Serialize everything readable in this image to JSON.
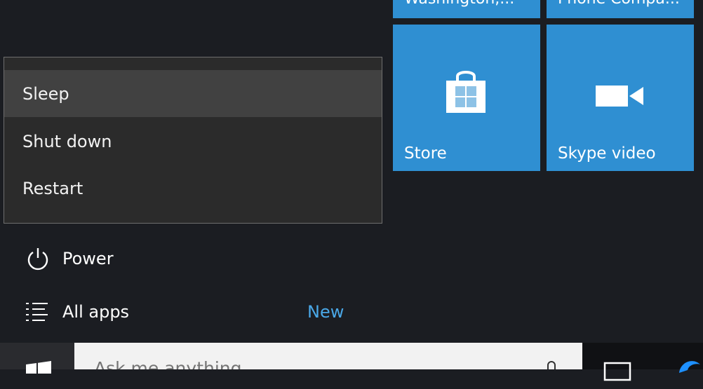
{
  "tiles": {
    "top_left_label": "Washington,...",
    "top_right_label": "Phone Compa...",
    "store_label": "Store",
    "skype_label": "Skype video"
  },
  "power_menu": {
    "items": [
      "Sleep",
      "Shut down",
      "Restart"
    ]
  },
  "left_menu": {
    "power_label": "Power",
    "all_apps_label": "All apps",
    "new_badge": "New"
  },
  "taskbar": {
    "search_placeholder": "Ask me anything"
  },
  "colors": {
    "tile_blue": "#2f8fd2",
    "accent_link": "#4aa8e8"
  },
  "icons": [
    "windows-logo-icon",
    "store-bag-icon",
    "video-camera-icon",
    "power-icon",
    "list-icon",
    "microphone-icon",
    "task-view-icon",
    "edge-icon"
  ]
}
